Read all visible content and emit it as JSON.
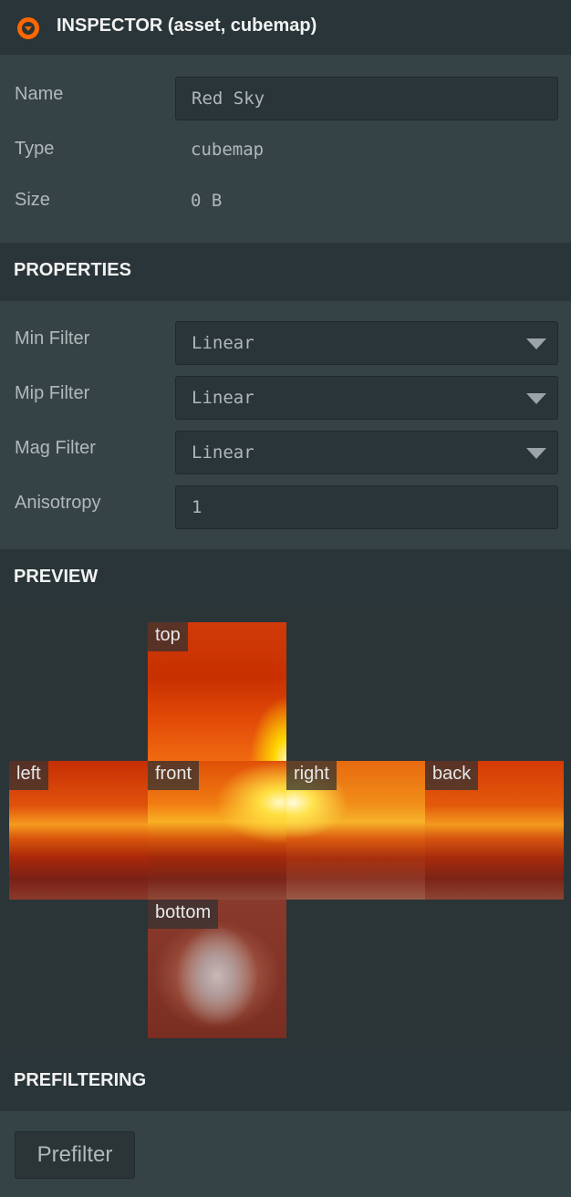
{
  "header": {
    "title": "INSPECTOR (asset, cubemap)",
    "icon": "collapse-icon",
    "accent": "#ff6600"
  },
  "fields": {
    "name_label": "Name",
    "name_value": "Red Sky",
    "type_label": "Type",
    "type_value": "cubemap",
    "size_label": "Size",
    "size_value": "0 B"
  },
  "properties": {
    "title": "PROPERTIES",
    "min_filter_label": "Min Filter",
    "min_filter_value": "Linear",
    "mip_filter_label": "Mip Filter",
    "mip_filter_value": "Linear",
    "mag_filter_label": "Mag Filter",
    "mag_filter_value": "Linear",
    "anisotropy_label": "Anisotropy",
    "anisotropy_value": "1"
  },
  "preview": {
    "title": "PREVIEW",
    "faces": {
      "top": "top",
      "left": "left",
      "front": "front",
      "right": "right",
      "back": "back",
      "bottom": "bottom"
    }
  },
  "prefiltering": {
    "title": "PREFILTERING",
    "button_label": "Prefilter"
  }
}
